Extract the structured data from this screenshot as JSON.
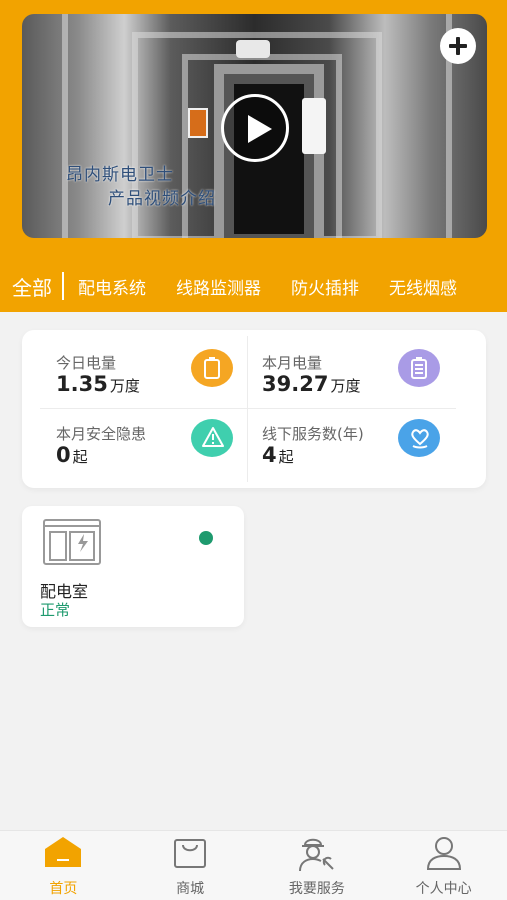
{
  "colors": {
    "accent": "#f2a300",
    "status_ok": "#1e9a6e",
    "icon_orange": "#f5a623",
    "icon_purple": "#a99be6",
    "icon_teal": "#3fcfae",
    "icon_blue": "#4aa3e8"
  },
  "video": {
    "caption_line1": "昂内斯电卫士",
    "caption_line2": "产品视频介绍",
    "play_icon": "play-icon",
    "add_icon": "plus-icon"
  },
  "category_tabs": [
    {
      "label": "全部",
      "active": true
    },
    {
      "label": "配电系统"
    },
    {
      "label": "线路监测器"
    },
    {
      "label": "防火插排"
    },
    {
      "label": "无线烟感"
    }
  ],
  "stats": [
    {
      "label": "今日电量",
      "value": "1.35",
      "unit": "万度",
      "icon": "battery-icon"
    },
    {
      "label": "本月电量",
      "value": "39.27",
      "unit": "万度",
      "icon": "clipboard-battery-icon"
    },
    {
      "label": "本月安全隐患",
      "value": "0",
      "unit": "起",
      "icon": "warning-icon"
    },
    {
      "label": "线下服务数(年)",
      "value": "4",
      "unit": "起",
      "icon": "service-heart-icon"
    }
  ],
  "room": {
    "name": "配电室",
    "status": "正常",
    "icon": "distribution-cabinet-icon"
  },
  "bottom_nav": [
    {
      "label": "首页",
      "icon": "home-icon",
      "active": true
    },
    {
      "label": "商城",
      "icon": "shopping-bag-icon"
    },
    {
      "label": "我要服务",
      "icon": "worker-service-icon"
    },
    {
      "label": "个人中心",
      "icon": "user-icon"
    }
  ]
}
